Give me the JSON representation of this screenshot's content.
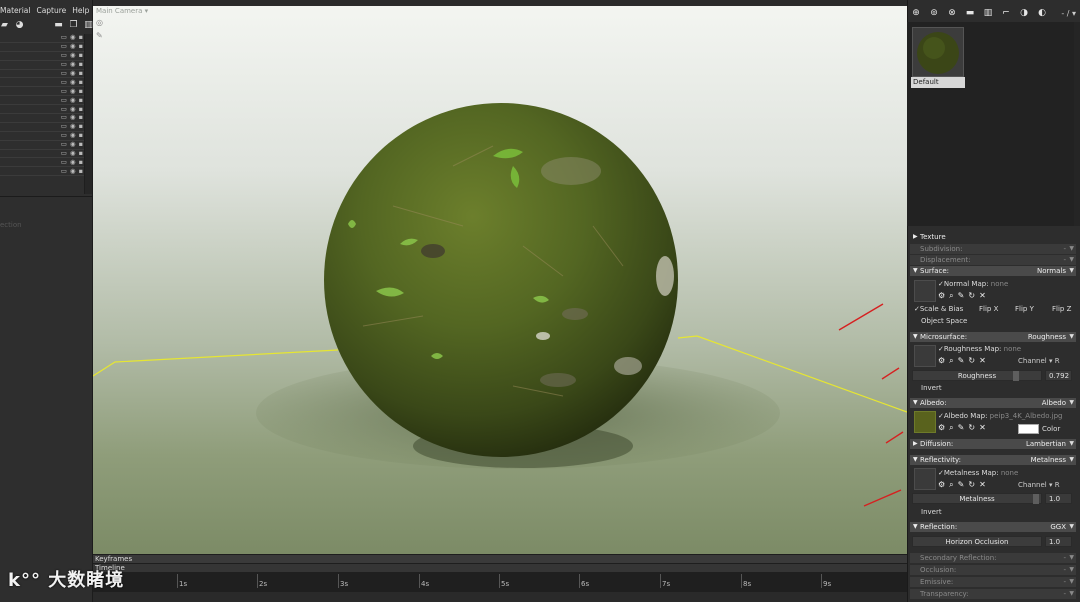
{
  "menu": {
    "items": [
      "Material",
      "Capture",
      "Help"
    ]
  },
  "left_panel": {
    "toolbar_icons": [
      "paint-icon",
      "sphere-icon",
      "folder-icon",
      "duplicate-icon",
      "trash-icon"
    ],
    "row_icons": [
      "lock-icon",
      "eye-icon",
      "dot-icon"
    ],
    "faint_text": "ection"
  },
  "viewport": {
    "title": "Main Camera ▾",
    "icons": [
      "light-icon",
      "brush-icon"
    ]
  },
  "timeline": {
    "keyframes_label": "Keyframes",
    "timeline_label": "Timeline",
    "ticks": [
      "1s",
      "2s",
      "3s",
      "4s",
      "5s",
      "6s",
      "7s",
      "8s",
      "9s"
    ]
  },
  "watermark": {
    "text": "大数睹境",
    "logo": "k°°"
  },
  "right_panel": {
    "toolbar_icons": [
      "add-icon",
      "duplicate-icon",
      "grid-icon",
      "folder-icon",
      "trash-icon",
      "eyedropper-icon",
      "sphere-icon",
      "settings-icon"
    ],
    "toolbar_text": "- / ▾",
    "material_name": "Default",
    "sections": {
      "texture": "Texture",
      "subdivision": {
        "label": "Subdivision:",
        "value": "-"
      },
      "displacement": {
        "label": "Displacement:",
        "value": "-"
      },
      "surface": {
        "label": "Surface:",
        "value": "Normals"
      },
      "microsurface": {
        "label": "Microsurface:",
        "value": "Roughness"
      },
      "albedo": {
        "label": "Albedo:",
        "value": "Albedo"
      },
      "diffusion": {
        "label": "Diffusion:",
        "value": "Lambertian"
      },
      "reflectivity": {
        "label": "Reflectivity:",
        "value": "Metalness"
      },
      "reflection": {
        "label": "Reflection:",
        "value": "GGX"
      },
      "secondary_reflection": {
        "label": "Secondary Reflection:",
        "value": "-"
      },
      "occlusion": {
        "label": "Occlusion:",
        "value": "-"
      },
      "emissive": {
        "label": "Emissive:",
        "value": "-"
      },
      "transparency": {
        "label": "Transparency:",
        "value": "-"
      }
    },
    "normal_map": {
      "label": "✓Normal Map:",
      "file": "none"
    },
    "surface_options": {
      "scale_bias": "✓Scale & Bias",
      "flip_x": "Flip X",
      "flip_y": "Flip Y",
      "flip_z": "Flip Z",
      "object_space": "Object Space"
    },
    "roughness_map": {
      "label": "✓Roughness Map:",
      "file": "none",
      "channel": "Channel ▾ R"
    },
    "roughness": {
      "label": "Roughness",
      "value": "0.792",
      "fraction": 0.792
    },
    "invert_label": "Invert",
    "albedo_map": {
      "label": "✓Albedo Map:",
      "file": "peip3_4K_Albedo.jpg",
      "color_label": "Color",
      "color": "#ffffff"
    },
    "metalness_map": {
      "label": "✓Metalness Map:",
      "file": "none",
      "channel": "Channel ▾ R"
    },
    "metalness": {
      "label": "Metalness",
      "value": "1.0",
      "fraction": 1.0
    },
    "invert2_label": "Invert",
    "horizon": {
      "label": "Horizon Occlusion",
      "value": "1.0"
    },
    "map_icons": [
      "gear-icon",
      "search-icon",
      "pencil-icon",
      "refresh-icon",
      "close-icon"
    ]
  },
  "colors": {
    "accent_arrow": "#d62020",
    "grid_line": "#e6e632",
    "panel_bg": "#2d2d2d",
    "section_bg": "#4a4a4a"
  }
}
